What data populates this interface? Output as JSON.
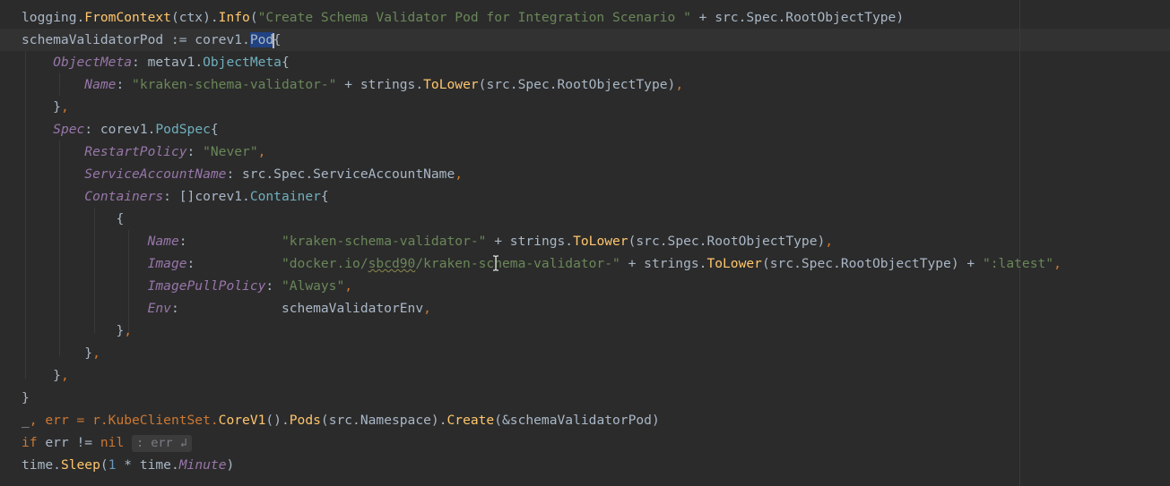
{
  "editor": {
    "lines": {
      "l1": {
        "a": "logging.",
        "b": "FromContext",
        "c": "(ctx).",
        "d": "Info",
        "e": "(",
        "f": "\"Create Schema Validator Pod for Integration Scenario \"",
        "g": " + src.Spec.RootObjectType)"
      },
      "l2": {
        "a": "schemaValidatorPod := corev1.",
        "b": "Pod",
        "c": "{"
      },
      "l3": {
        "a": "ObjectMeta",
        "b": ": metav1.",
        "c": "ObjectMeta",
        "d": "{"
      },
      "l4": {
        "a": "Name",
        "b": ": ",
        "c": "\"kraken-schema-validator-\"",
        "d": " + strings.",
        "e": "ToLower",
        "f": "(src.Spec.RootObjectType)",
        "g": ","
      },
      "l5": {
        "a": "}",
        "b": ","
      },
      "l6": {
        "a": "Spec",
        "b": ": corev1.",
        "c": "PodSpec",
        "d": "{"
      },
      "l7": {
        "a": "RestartPolicy",
        "b": ": ",
        "c": "\"Never\"",
        "d": ","
      },
      "l8": {
        "a": "ServiceAccountName",
        "b": ": src.Spec.ServiceAccountName",
        "c": ","
      },
      "l9": {
        "a": "Containers",
        "b": ": []corev1.",
        "c": "Container",
        "d": "{"
      },
      "l10": {
        "a": "{"
      },
      "l11": {
        "a": "Name",
        "b": ":            ",
        "c": "\"kraken-schema-validator-\"",
        "d": " + strings.",
        "e": "ToLower",
        "f": "(src.Spec.RootObjectType)",
        "g": ","
      },
      "l12": {
        "a": "Image",
        "b": ":           ",
        "c1": "\"docker.io/",
        "c2": "sbcd90",
        "c3": "/kraken-schema-validator-\"",
        "d": " + strings.",
        "e": "ToLower",
        "f": "(src.Spec.RootObjectType) + ",
        "g": "\":latest\"",
        "h": ","
      },
      "l13": {
        "a": "ImagePullPolicy",
        "b": ": ",
        "c": "\"Always\"",
        "d": ","
      },
      "l14": {
        "a": "Env",
        "b": ":             schemaValidatorEnv",
        "c": ","
      },
      "l15": {
        "a": "}",
        "b": ","
      },
      "l16": {
        "a": "}",
        "b": ","
      },
      "l17": {
        "a": "}",
        "b": ","
      },
      "l18": {
        "a": "}"
      },
      "l19": {
        "a": "_",
        "b": ", err = r.KubeClientSet.",
        "c": "CoreV1",
        "d": "().",
        "e": "Pods",
        "f": "(src.Namespace).",
        "g": "Create",
        "h": "(&schemaValidatorPod)"
      },
      "l20": {
        "a": "if",
        "b": " err != ",
        "c": "nil",
        "d": " ",
        "hint": ": err ↲"
      },
      "l21": {
        "a": "time.",
        "b": "Sleep",
        "c": "(",
        "d": "1",
        "e": " * time.",
        "f": "Minute",
        "g": ")"
      }
    }
  },
  "colors": {
    "background": "#2b2b2b",
    "text": "#a9b7c6",
    "function": "#ffc66d",
    "string": "#6a8759",
    "keyword": "#cc7832",
    "field": "#9876aa",
    "selection": "#214283"
  },
  "icons": {
    "cursor": "text-ibeam-icon"
  }
}
